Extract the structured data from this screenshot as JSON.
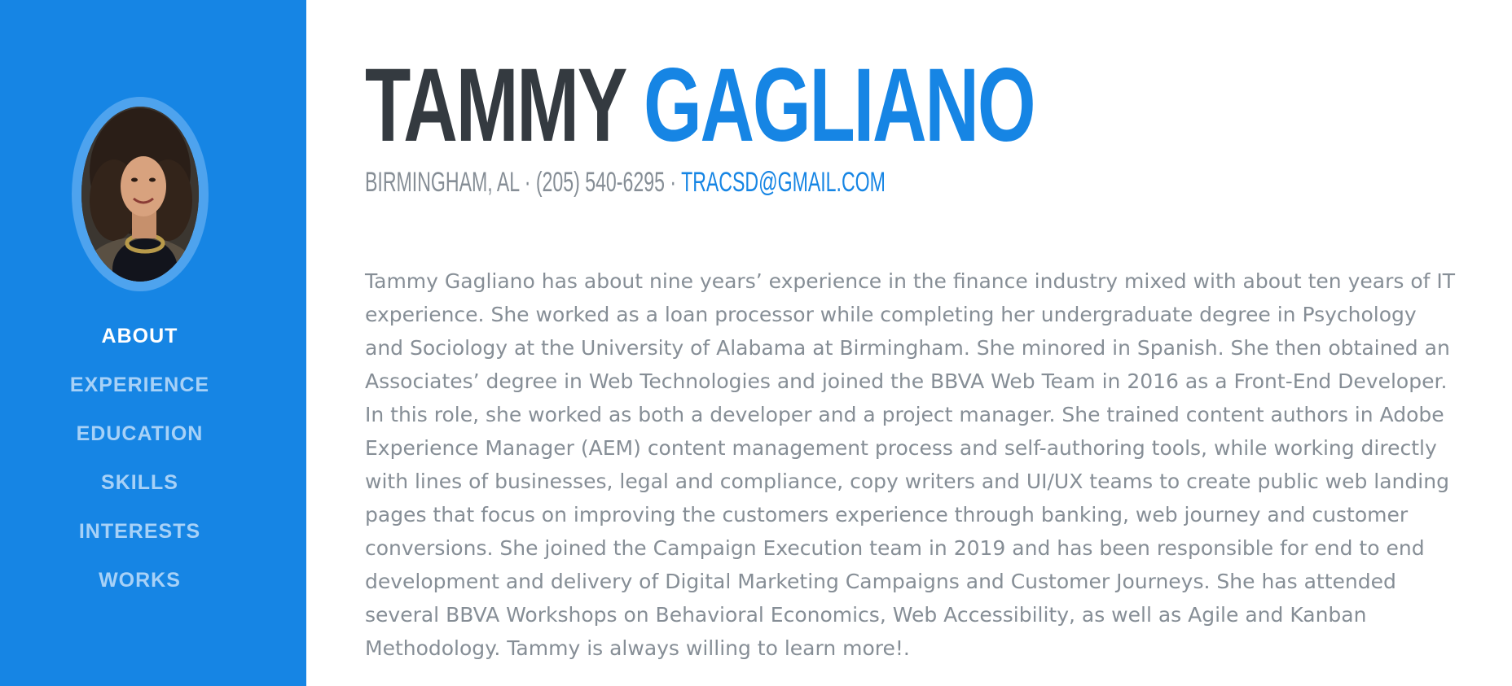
{
  "sidebar": {
    "bg_color": "#1685e4",
    "avatar": "profile-photo",
    "nav": [
      {
        "label": "ABOUT",
        "active": true
      },
      {
        "label": "EXPERIENCE",
        "active": false
      },
      {
        "label": "EDUCATION",
        "active": false
      },
      {
        "label": "SKILLS",
        "active": false
      },
      {
        "label": "INTERESTS",
        "active": false
      },
      {
        "label": "WORKS",
        "active": false
      }
    ]
  },
  "header": {
    "first_name": "TAMMY",
    "last_name": "GAGLIANO",
    "location": "BIRMINGHAM, AL",
    "separator": " · ",
    "phone": "(205) 540-6295",
    "email": "TRACSD@GMAIL.COM",
    "accent_color": "#1685e4",
    "name_color": "#343a40"
  },
  "about": {
    "bio": "Tammy Gagliano has about nine years’ experience in the finance industry mixed with about ten years of IT experience. She worked as a loan processor while completing her undergraduate degree in Psychology and Sociology at the University of Alabama at Birmingham. She minored in Spanish. She then obtained an Associates’ degree in Web Technologies and joined the BBVA Web Team in 2016 as a Front-End Developer. In this role, she worked as both a developer and a project manager. She trained content authors in Adobe Experience Manager (AEM) content management process and self-authoring tools, while working directly with lines of businesses, legal and compliance, copy writers and UI/UX teams to create public web landing pages that focus on improving the customers experience through banking, web journey and customer conversions. She joined the Campaign Execution team in 2019 and has been responsible for end to end development and delivery of Digital Marketing Campaigns and Customer Journeys. She has attended several BBVA Workshops on Behavioral Economics, Web Accessibility, as well as Agile and Kanban Methodology. Tammy is always willing to learn more!."
  }
}
